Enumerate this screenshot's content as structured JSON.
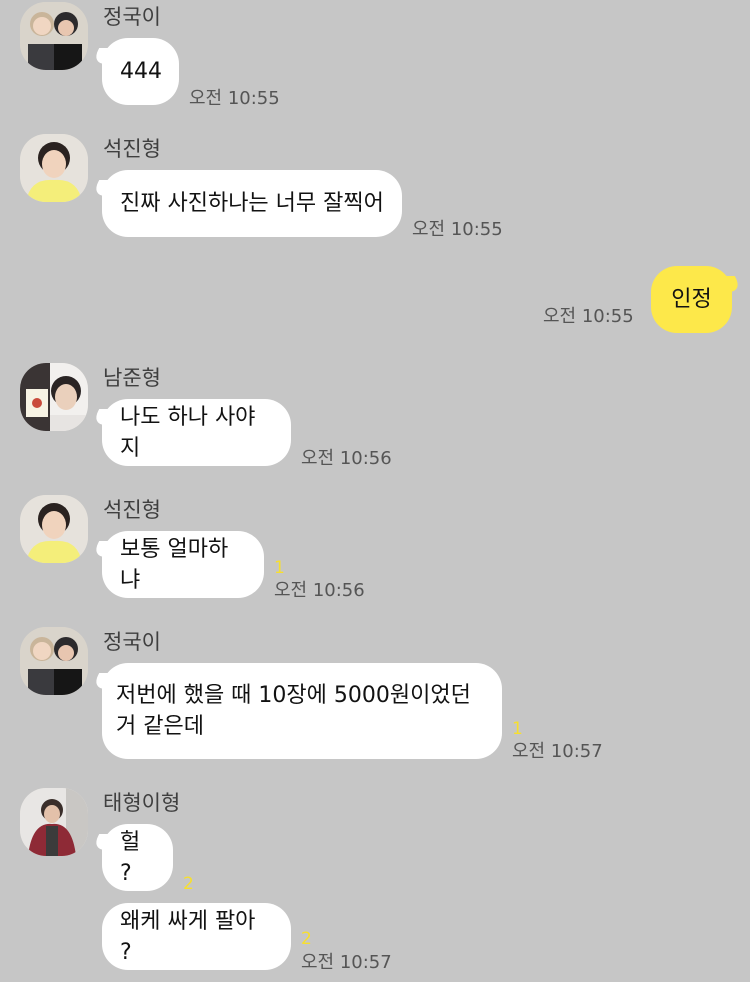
{
  "messages": [
    {
      "sender": "정국이",
      "text": "444",
      "time": "오전 10:55"
    },
    {
      "sender": "석진형",
      "text": "진짜 사진하나는 너무 잘찍어",
      "time": "오전 10:55"
    },
    {
      "sender": "me",
      "text": "인정",
      "time": "오전 10:55"
    },
    {
      "sender": "남준형",
      "text": "나도 하나 사야지",
      "time": "오전 10:56"
    },
    {
      "sender": "석진형",
      "text": "보통 얼마하냐",
      "time": "오전 10:56",
      "unread": "1"
    },
    {
      "sender": "정국이",
      "text": "저번에 했을 때 10장에 5000원이었던\n거 같은데",
      "time": "오전 10:57",
      "unread": "1"
    },
    {
      "sender": "태형이형",
      "text": "헐 ?",
      "unread": "2"
    },
    {
      "sender": "태형이형",
      "text": "왜케 싸게 팔아 ?",
      "time": "오전 10:57",
      "unread": "2"
    }
  ],
  "colors": {
    "background": "#c6c6c6",
    "my_bubble": "#fde84a",
    "their_bubble": "#ffffff",
    "unread_count": "#f7df2e"
  }
}
